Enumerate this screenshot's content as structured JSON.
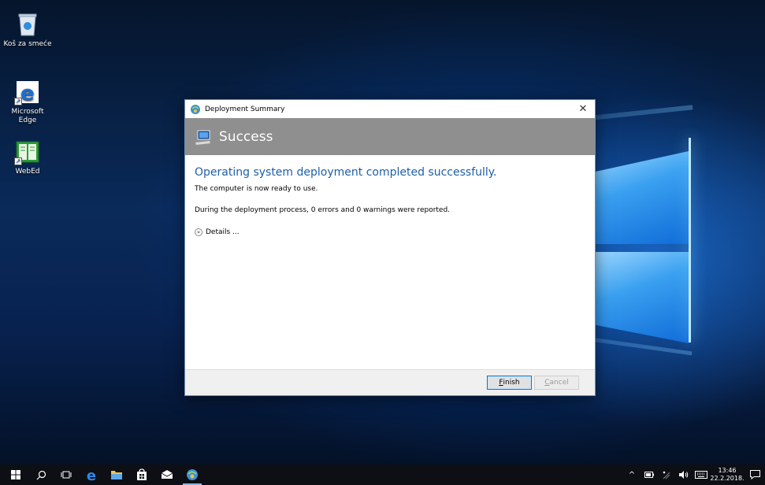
{
  "desktop": {
    "icons": [
      {
        "label": "Koš za smeće",
        "icon": "recycle-bin-icon"
      },
      {
        "label": "Microsoft Edge",
        "icon": "edge-icon"
      },
      {
        "label": "WebEd",
        "icon": "webed-icon"
      }
    ]
  },
  "dialog": {
    "title": "Deployment Summary",
    "close_glyph": "✕",
    "banner": "Success",
    "headline": "Operating system deployment completed successfully.",
    "line1": "The computer is now ready to use.",
    "line2": "During the deployment process, 0 errors and 0 warnings were reported.",
    "details_label": "Details ...",
    "finish_accel": "F",
    "finish_rest": "inish",
    "cancel_accel": "C",
    "cancel_rest": "ancel"
  },
  "taskbar": {
    "items": [
      "start-icon",
      "search-icon",
      "task-view-icon",
      "edge-icon",
      "file-explorer-icon",
      "store-icon",
      "mail-icon",
      "deployment-icon"
    ],
    "tray": {
      "up_glyph": "^",
      "time": "13:46",
      "date": "22.2.2018."
    }
  },
  "colors": {
    "banner": "#8f8f8f",
    "headline": "#1f5fa8",
    "taskbar": "#0d0f14"
  }
}
